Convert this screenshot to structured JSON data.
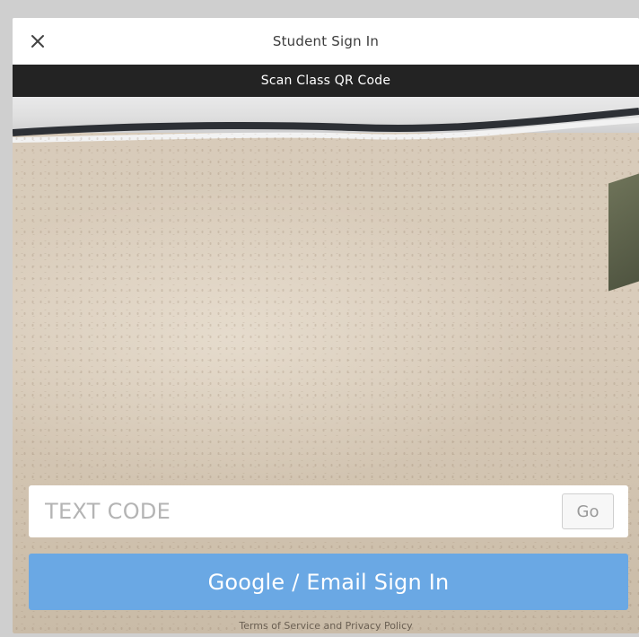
{
  "header": {
    "title": "Student Sign In",
    "close_icon": "close-icon"
  },
  "scan_bar": {
    "label": "Scan Class QR Code"
  },
  "text_code": {
    "placeholder": "TEXT CODE",
    "value": "",
    "go_label": "Go"
  },
  "sign_in": {
    "label": "Google / Email Sign In"
  },
  "footer": {
    "links_text": "Terms of Service and Privacy Policy"
  },
  "colors": {
    "scan_bar_bg": "#232323",
    "sign_in_bg": "#6aa8e4",
    "modal_bg": "#ffffff"
  }
}
